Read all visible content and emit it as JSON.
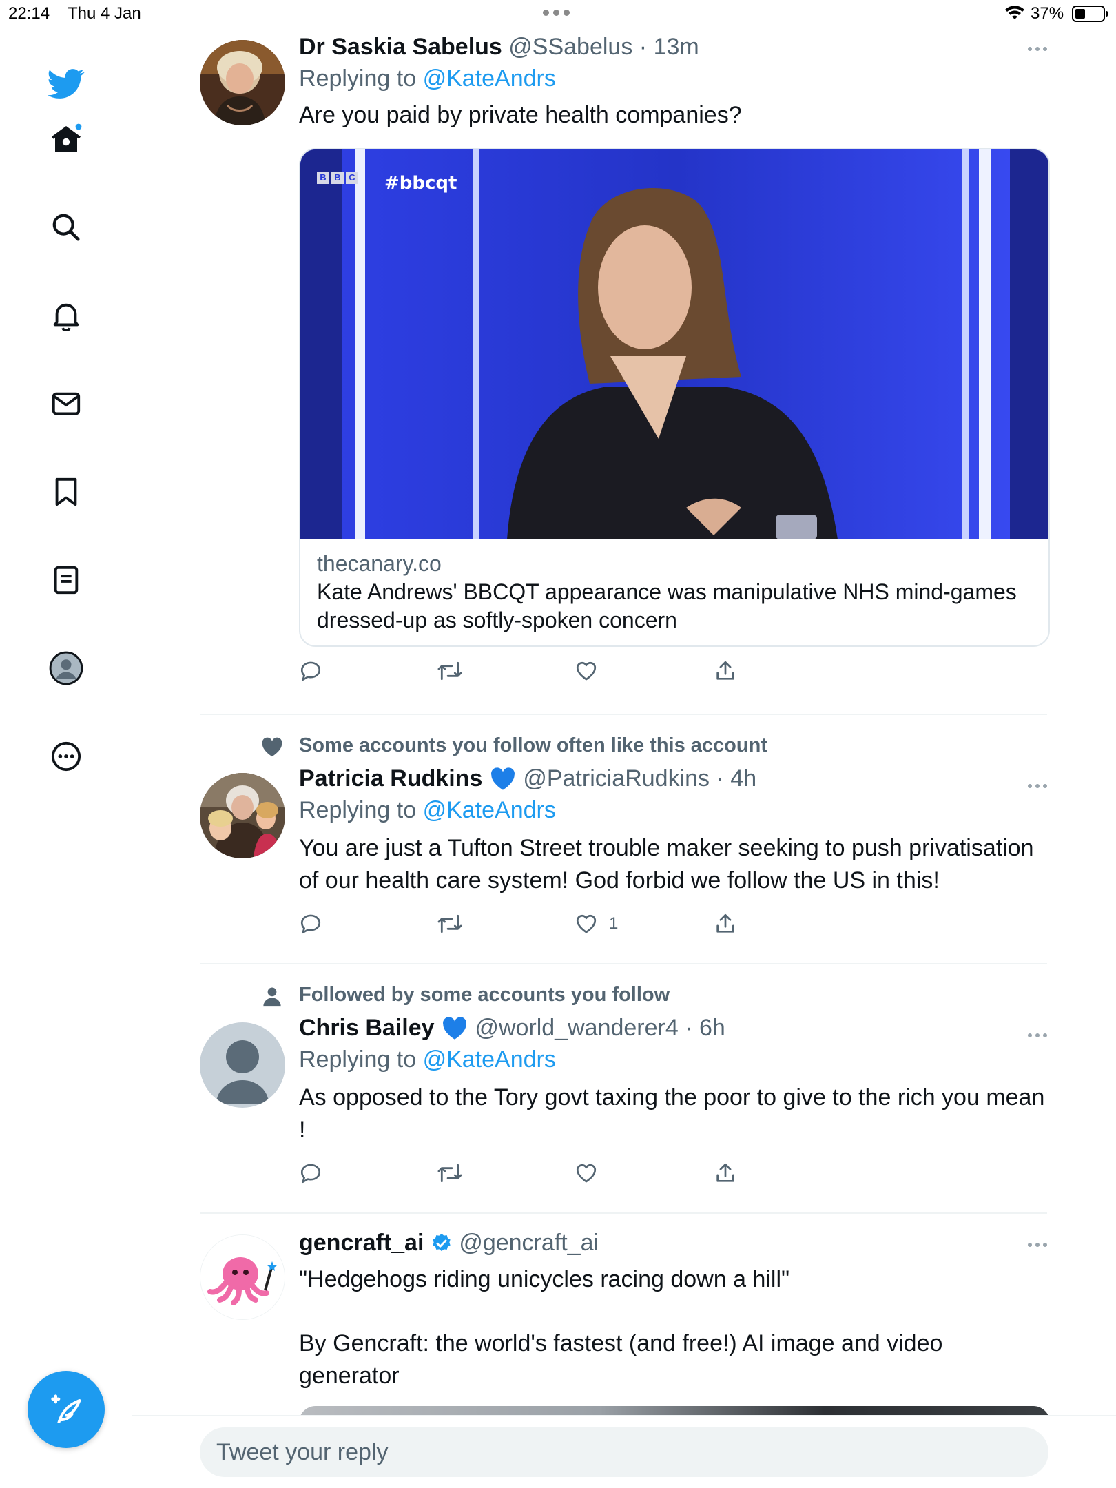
{
  "status_bar": {
    "time": "22:14",
    "date": "Thu 4 Jan",
    "battery": "37%"
  },
  "colors": {
    "accent": "#1d9bf0",
    "text_primary": "#0f1419",
    "text_secondary": "#536471",
    "divider": "#eff3f4"
  },
  "sidebar": {
    "items": [
      {
        "icon": "twitter-logo-icon"
      },
      {
        "icon": "home-icon"
      },
      {
        "icon": "search-icon"
      },
      {
        "icon": "notifications-bell-icon"
      },
      {
        "icon": "messages-envelope-icon"
      },
      {
        "icon": "bookmark-icon"
      },
      {
        "icon": "lists-icon"
      },
      {
        "icon": "profile-icon"
      },
      {
        "icon": "more-circle-icon"
      }
    ],
    "compose_icon": "compose-tweet-icon"
  },
  "tweets": [
    {
      "name": "Dr Saskia Sabelus",
      "handle": "@SSabelus",
      "time": "13m",
      "replying_label": "Replying to",
      "replying_to": "@KateAndrs",
      "text": "Are you paid by private health companies?",
      "card": {
        "media_overlay": "#bbcqt",
        "domain": "thecanary.co",
        "title": "Kate Andrews' BBCQT appearance was manipulative NHS mind-games dressed-up as softly-spoken concern"
      },
      "likes": ""
    },
    {
      "context": "Some accounts you follow often like this account",
      "name": "Patricia Rudkins",
      "handle": "@PatriciaRudkins",
      "time": "4h",
      "replying_label": "Replying to",
      "replying_to": "@KateAndrs",
      "text": "You are just a Tufton Street trouble maker seeking to push privatisation of our health care system! God forbid we follow the US in this!",
      "likes": "1"
    },
    {
      "context": "Followed by some accounts you follow",
      "name": "Chris Bailey",
      "handle": "@world_wanderer4",
      "time": "6h",
      "replying_label": "Replying to",
      "replying_to": "@KateAndrs",
      "text": "As opposed to the Tory govt taxing the poor to give to the rich you mean !",
      "likes": ""
    },
    {
      "name": "gencraft_ai",
      "handle": "@gencraft_ai",
      "text_line1": "\"Hedgehogs riding unicycles racing down a hill\"",
      "text_line2": "By Gencraft: the world's fastest (and free!) AI image and video generator"
    }
  ],
  "reply_bar": {
    "placeholder": "Tweet your reply"
  }
}
